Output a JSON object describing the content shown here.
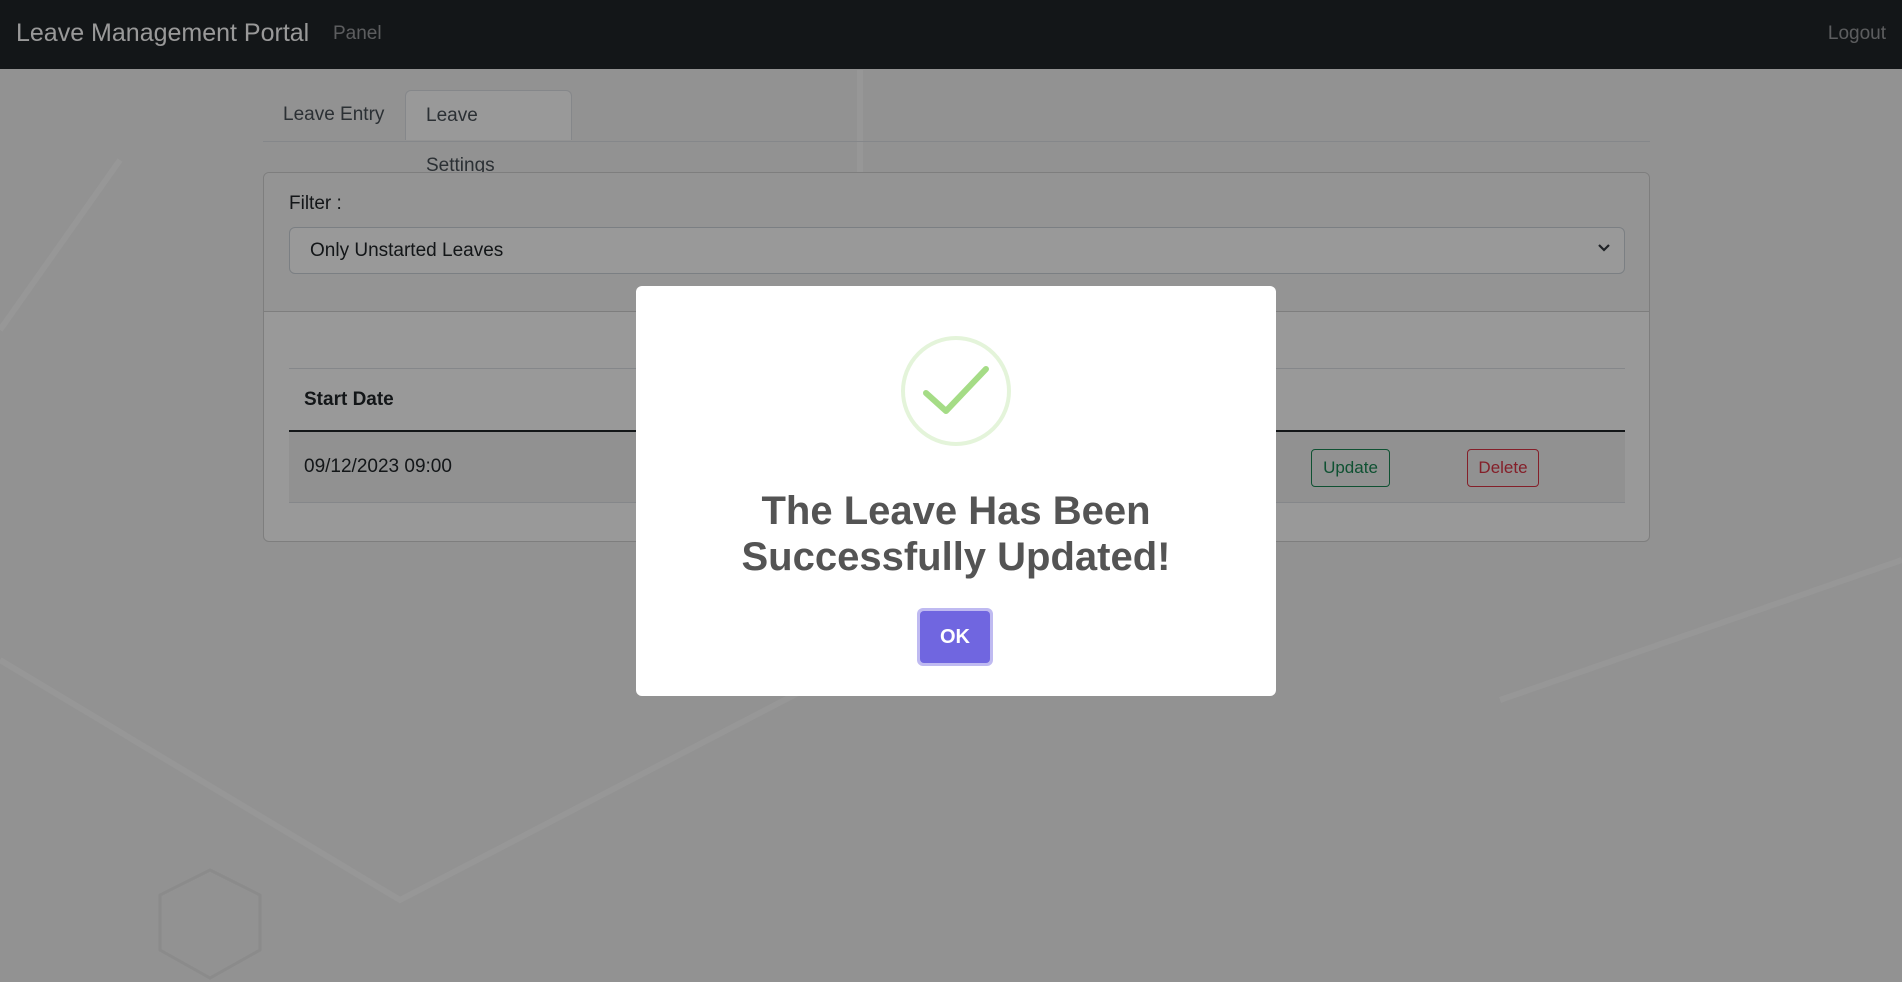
{
  "navbar": {
    "brand": "Leave Management Portal",
    "panel_link": "Panel",
    "logout_link": "Logout"
  },
  "tabs": [
    {
      "label": "Leave Entry",
      "active": false
    },
    {
      "label": "Leave Settings",
      "active": true
    }
  ],
  "filter": {
    "label": "Filter :",
    "selected": "Only Unstarted Leaves"
  },
  "table": {
    "headers": [
      "Start Date"
    ],
    "rows": [
      {
        "start_date": "09/12/2023 09:00",
        "update_label": "Update",
        "delete_label": "Delete"
      }
    ]
  },
  "modal": {
    "icon": "success-check-icon",
    "title": "The Leave Has Been Successfully Updated!",
    "ok_label": "OK"
  },
  "colors": {
    "navbar": "#212529",
    "ok_button": "#7066e0",
    "success": "#a5dc86",
    "update": "#198754",
    "delete": "#dc3545"
  }
}
